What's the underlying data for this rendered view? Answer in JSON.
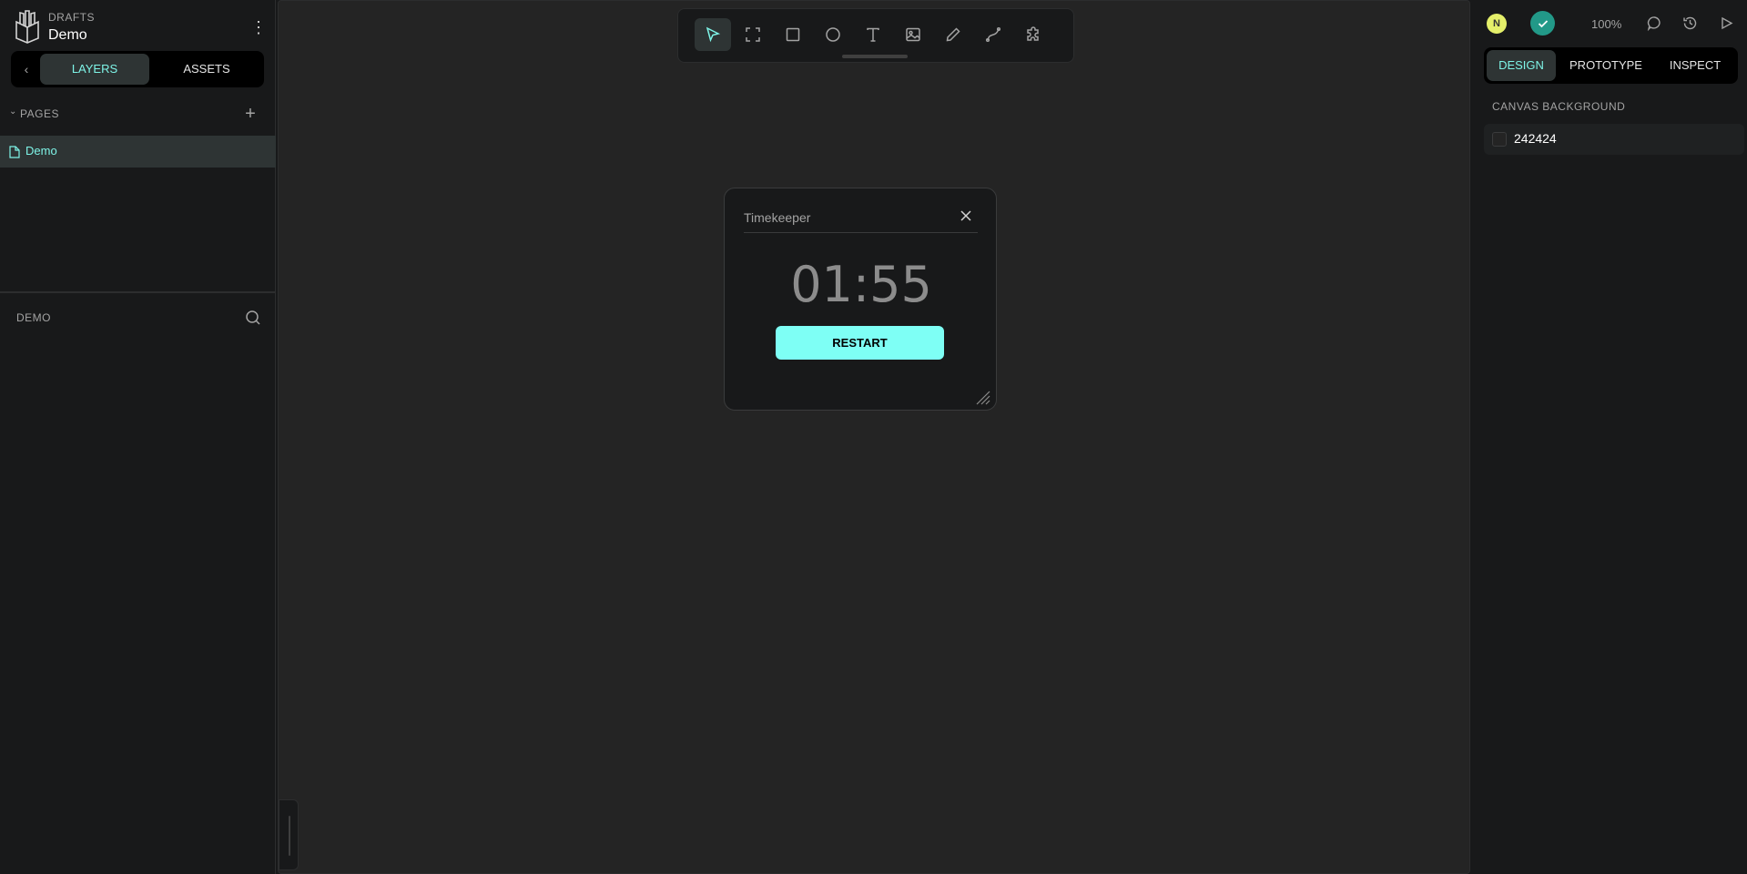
{
  "project": {
    "section": "DRAFTS",
    "name": "Demo"
  },
  "left_tabs": {
    "layers": "LAYERS",
    "assets": "ASSETS"
  },
  "pages": {
    "label": "PAGES",
    "items": [
      {
        "label": "Demo",
        "selected": true
      }
    ]
  },
  "layers": {
    "title": "DEMO"
  },
  "toolbar": {
    "tools": [
      "pointer-icon",
      "board-icon",
      "rectangle-icon",
      "ellipse-icon",
      "text-icon",
      "image-icon",
      "pencil-icon",
      "path-icon",
      "plugins-icon"
    ],
    "active": "pointer-icon"
  },
  "widget": {
    "title": "Timekeeper",
    "time": "01:55",
    "button_label": "RESTART"
  },
  "header": {
    "avatar_initial": "N",
    "zoom": "100%"
  },
  "right_tabs": {
    "design": "DESIGN",
    "prototype": "PROTOTYPE",
    "inspect": "INSPECT"
  },
  "canvas_background": {
    "label": "CANVAS BACKGROUND",
    "value": "242424"
  },
  "colors": {
    "accent": "#7ef4e7",
    "button": "#7efff5",
    "canvas": "#242424",
    "panel": "#18191a",
    "status": "#229988",
    "avatar": "#e4ef6a"
  }
}
